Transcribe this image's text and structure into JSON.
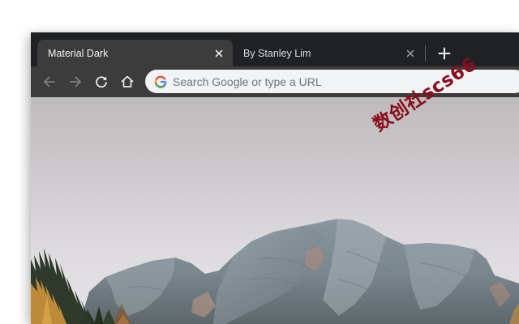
{
  "browser": {
    "tabs": [
      {
        "title": "Material Dark",
        "active": true
      },
      {
        "title": "By Stanley Lim",
        "active": false
      }
    ],
    "toolbar": {
      "buttons": [
        "back-arrow-icon",
        "forward-arrow-icon",
        "reload-icon",
        "home-icon"
      ]
    },
    "omnibox": {
      "placeholder": "Search Google or type a URL",
      "icon": "google-g-icon"
    },
    "new_tab_icon": "plus-icon"
  },
  "content": {
    "background": "mountain landscape with grey rocky peaks, autumn larch trees and overcast sky"
  },
  "watermark": {
    "text": "数创社scs66"
  },
  "colors": {
    "tabstrip": "#202124",
    "active_tab": "#3c3c3c",
    "toolbar": "#3c3c3c",
    "omnibox": "#f1f3f4",
    "watermark": "#8b0c1c"
  }
}
